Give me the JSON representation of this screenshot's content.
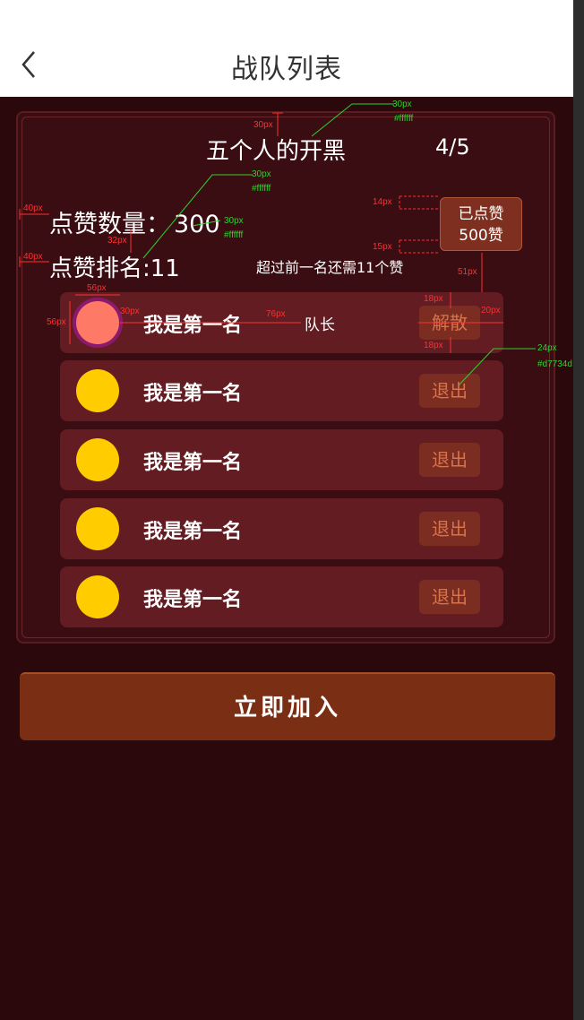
{
  "nav": {
    "title": "战队列表",
    "back_icon": "chevron-left-icon"
  },
  "team": {
    "name": "五个人的开黑",
    "member_count": "4/5",
    "like_count_label": "点赞数量：",
    "like_count_value": "300",
    "like_rank_label": "点赞排名:",
    "like_rank_value": "11",
    "exceed_hint": "超过前一名还需11个赞",
    "liked_button": {
      "line1": "已点赞",
      "line2": "500赞"
    }
  },
  "members": [
    {
      "name": "我是第一名",
      "tag": "队长",
      "action": "解散",
      "avatar_color": "#fe7a67"
    },
    {
      "name": "我是第一名",
      "tag": "",
      "action": "退出",
      "avatar_color": "#ffcc00"
    },
    {
      "name": "我是第一名",
      "tag": "",
      "action": "退出",
      "avatar_color": "#ffcc00"
    },
    {
      "name": "我是第一名",
      "tag": "",
      "action": "退出",
      "avatar_color": "#ffcc00"
    },
    {
      "name": "我是第一名",
      "tag": "",
      "action": "退出",
      "avatar_color": "#ffcc00"
    }
  ],
  "join_button": "立即加入",
  "colors": {
    "background": "#2a080b",
    "panel": "#3a0d12",
    "row": "#621c22",
    "button": "#7a2d20",
    "button_text": "#d7734d",
    "join_button": "#7a2e14"
  },
  "annotations": {
    "a1": "30px",
    "a2": "#ffffff",
    "a3": "30px",
    "a4": "30px",
    "a5": "#ffffff",
    "a6": "#ffffff",
    "a7": "30px",
    "a8": "40px",
    "a9": "40px",
    "a10": "32px",
    "a11": "14px",
    "a12": "15px",
    "a13": "51px",
    "a14": "56px",
    "a15": "56px",
    "a16": "30px",
    "a17": "76px",
    "a18": "18px",
    "a19": "20px",
    "a20": "18px",
    "a21": "24px",
    "a22": "#d7734d"
  }
}
